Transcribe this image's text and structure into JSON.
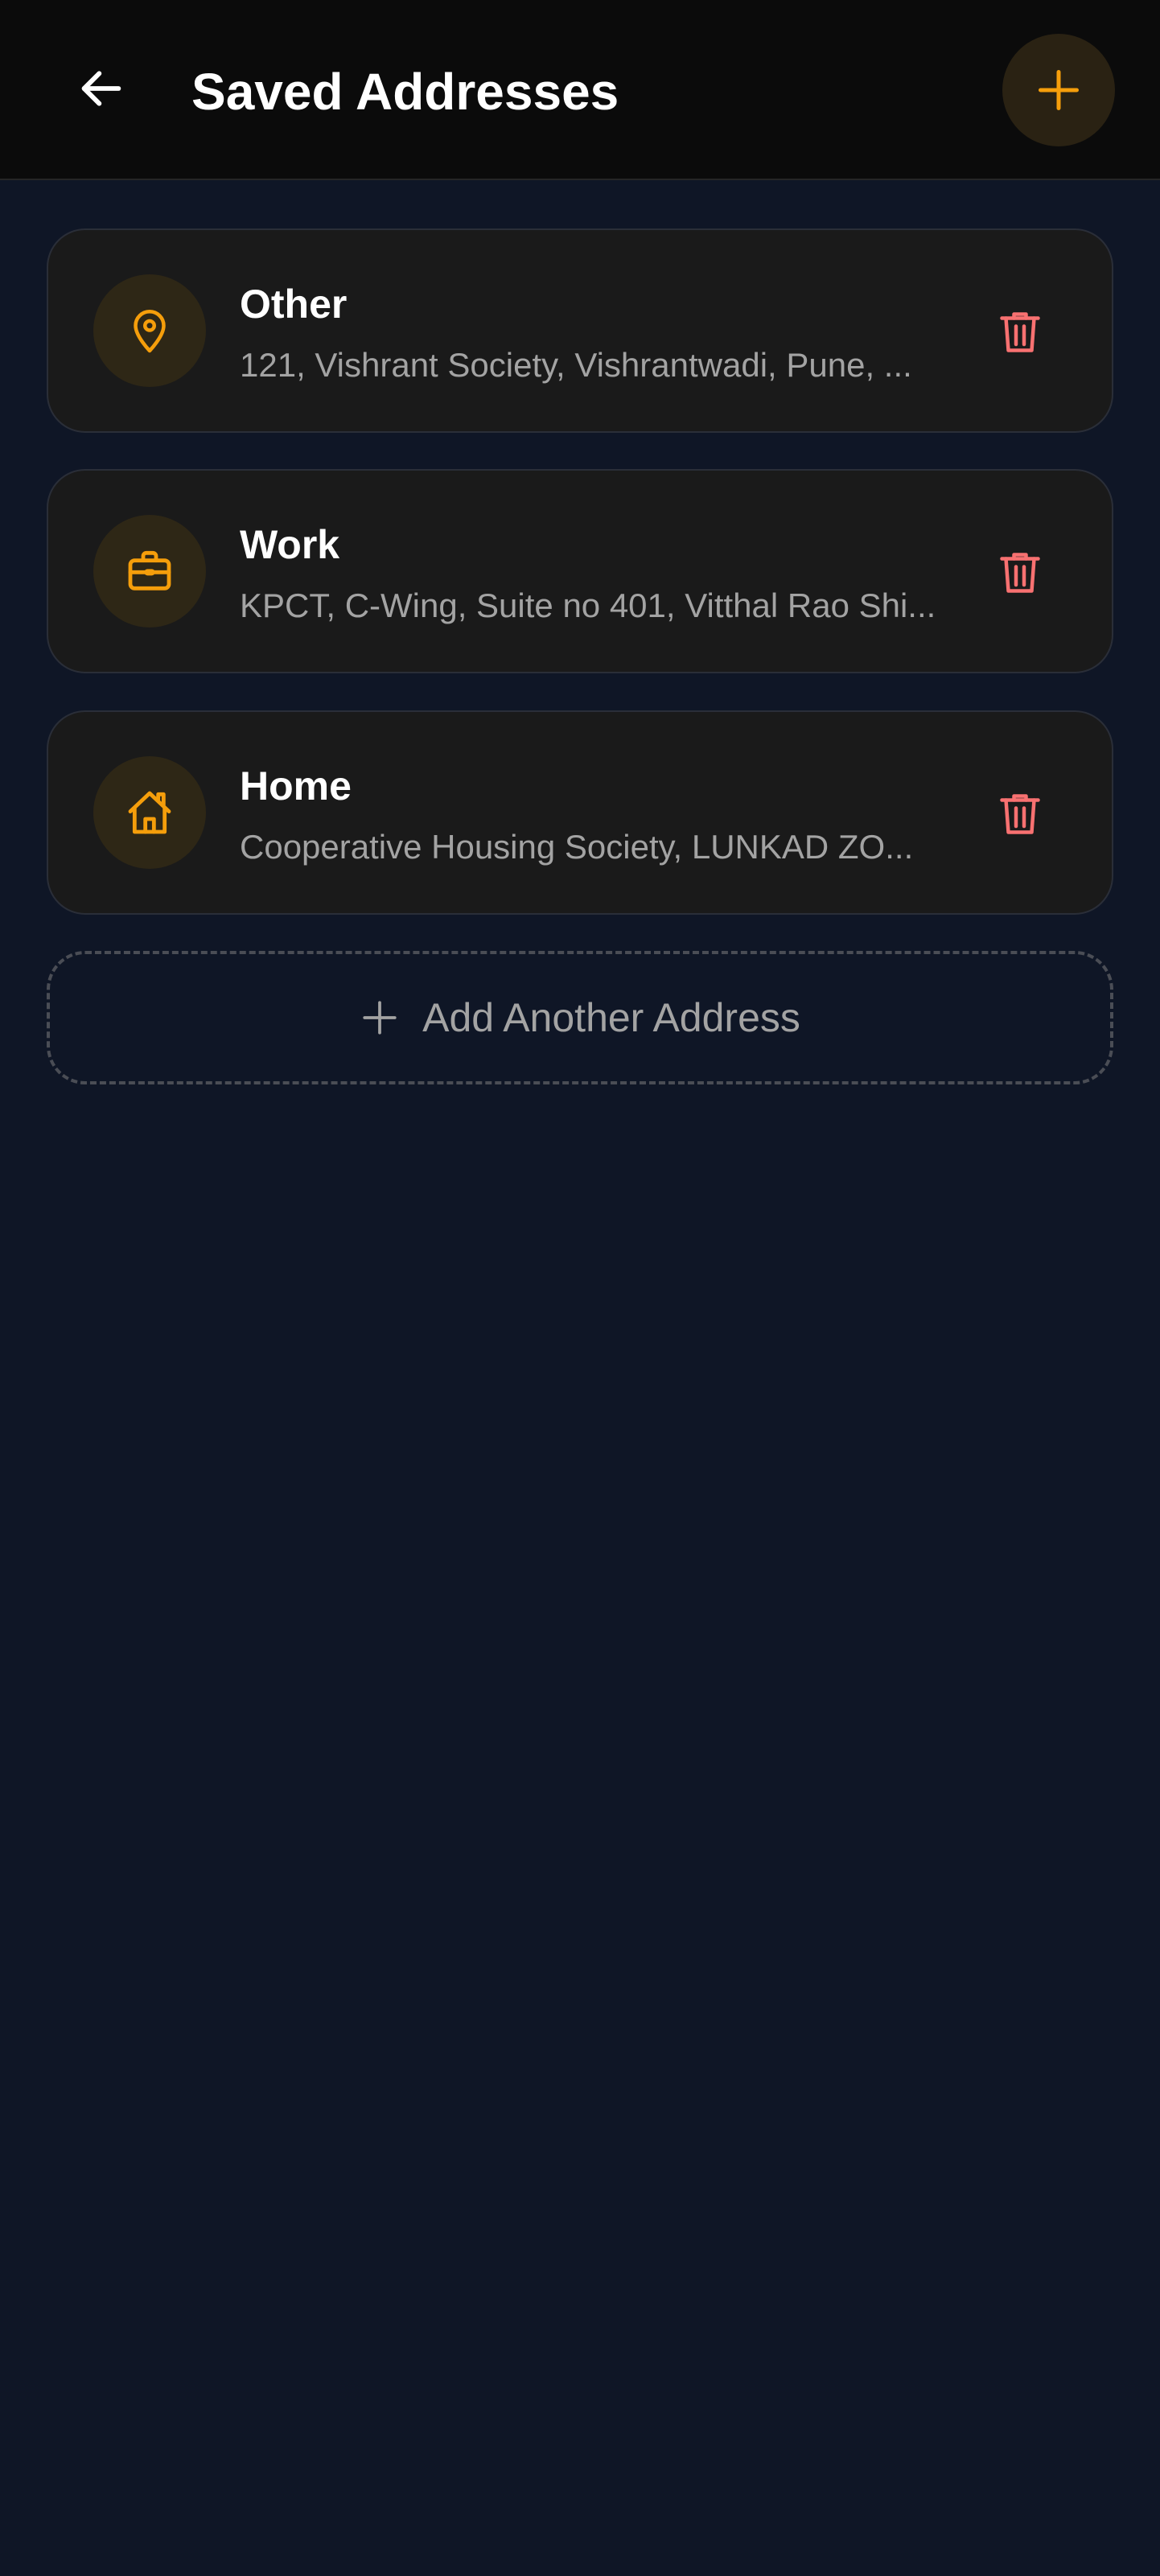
{
  "header": {
    "title": "Saved Addresses",
    "back_icon": "arrow-left-icon",
    "add_icon": "plus-icon"
  },
  "addresses": [
    {
      "label": "Other",
      "address": "121, Vishrant Society, Vishrantwadi, Pune, ...",
      "icon": "map-pin-icon"
    },
    {
      "label": "Work",
      "address": "KPCT, C-Wing, Suite no 401, Vitthal Rao Shi...",
      "icon": "briefcase-icon"
    },
    {
      "label": "Home",
      "address": "Cooperative Housing Society, LUNKAD ZO...",
      "icon": "home-icon"
    }
  ],
  "add_another": {
    "label": "Add Another Address",
    "icon": "plus-icon"
  },
  "colors": {
    "background": "#0f1626",
    "header_bg": "#0b0b0b",
    "card_bg": "#1a1a1a",
    "accent": "#f59e0b",
    "delete": "#f87171",
    "muted_text": "#a3a3a3"
  }
}
